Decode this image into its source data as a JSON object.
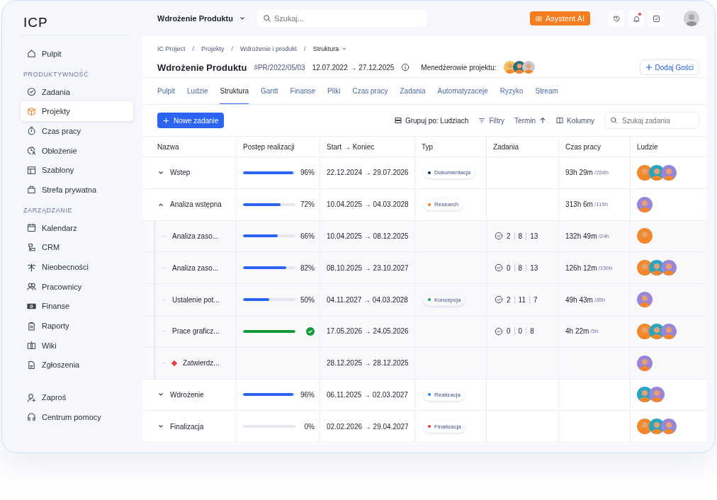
{
  "app": {
    "logo": "ICP"
  },
  "sidebar": {
    "top": [
      {
        "label": "Pulpit",
        "selected": false
      }
    ],
    "sections": [
      {
        "title": "PRODUKTYWNOŚĆ",
        "items": [
          {
            "label": "Zadania",
            "selected": false
          },
          {
            "label": "Projekty",
            "selected": true
          },
          {
            "label": "Czas pracy",
            "selected": false
          },
          {
            "label": "Obłożenie",
            "selected": false
          },
          {
            "label": "Szablony",
            "selected": false
          },
          {
            "label": "Strefa prywatna",
            "selected": false
          }
        ]
      },
      {
        "title": "ZARZĄDZANIE",
        "items": [
          {
            "label": "Kalendarz",
            "selected": false
          },
          {
            "label": "CRM",
            "selected": false
          },
          {
            "label": "Nieobecności",
            "selected": false
          },
          {
            "label": "Pracownicy",
            "selected": false
          },
          {
            "label": "Finanse",
            "selected": false
          },
          {
            "label": "Raporty",
            "selected": false
          },
          {
            "label": "Wiki",
            "selected": false
          },
          {
            "label": "Zgłoszenia",
            "selected": false
          }
        ]
      }
    ],
    "bottom": [
      {
        "label": "Zaproś",
        "selected": false
      },
      {
        "label": "Centrum pomocy",
        "selected": false
      }
    ]
  },
  "topbar": {
    "project": "Wdrożenie Produktu",
    "search": {
      "placeholder": "Szukaj..."
    },
    "assistant": "Asystent AI",
    "unread": true
  },
  "header": {
    "breadcrumb": [
      "IC Project",
      "Projekty",
      "Wdrożenie i produkt",
      "Struktura"
    ],
    "separator": "/",
    "title": "Wdrożenie Produktu",
    "code": "#PR/2022/05/03",
    "dates": "12.07.2022 → 27.12.2025",
    "managers_label": "Menedżerowie projektu:",
    "managers": [
      {
        "color": "#f0c25a"
      },
      {
        "color": "#2f6f78"
      },
      {
        "color": "#c9c9cc"
      }
    ],
    "guest_button": "Dodaj Gości"
  },
  "tabs": [
    {
      "label": "Pulpit",
      "selected": false
    },
    {
      "label": "Ludzie",
      "selected": false
    },
    {
      "label": "Struktura",
      "selected": true
    },
    {
      "label": "Gantt",
      "selected": false
    },
    {
      "label": "Finanse",
      "selected": false
    },
    {
      "label": "Pliki",
      "selected": false
    },
    {
      "label": "Czas pracy",
      "selected": false
    },
    {
      "label": "Zadania",
      "selected": false
    },
    {
      "label": "Automatyzaceje",
      "selected": false
    },
    {
      "label": "Ryzyko",
      "selected": false
    },
    {
      "label": "Stream",
      "selected": false
    }
  ],
  "toolbar": {
    "new_task": "Nowe zadanie",
    "group_by": "Grupuj po: Ludziach",
    "filters": "Filtry",
    "sort": "Termin",
    "columns": "Kolumny",
    "search": {
      "placeholder": "Szukaj zadania"
    }
  },
  "table": {
    "columns": [
      "Nazwa",
      "Postęp realizacji",
      "Start → Koniec",
      "Typ",
      "Zadania",
      "Czas pracy",
      "Ludzie"
    ],
    "rows": [
      {
        "kind": "group",
        "name": "Wstep",
        "expanded": false,
        "level": 0.96,
        "percent": "96%",
        "dates": "22.12.2024 → 29.07.2026",
        "type": {
          "label": "Dokumentacja",
          "color": "#1b2a5c"
        },
        "time": "93h 29m",
        "budget": "/258h",
        "people": [
          {
            "color": "#f08a2c"
          },
          {
            "color": "#2aa5c0"
          },
          {
            "color": "#9a86d8"
          }
        ]
      },
      {
        "kind": "group",
        "name": "Analiza wstępna",
        "expanded": true,
        "level": 0.72,
        "percent": "72%",
        "dates": "10.04.2025 → 04.03.2028",
        "type": {
          "label": "Research",
          "color": "#f57c1f"
        },
        "time": "313h 6m",
        "budget": "/115h",
        "people": [
          {
            "color": "#9a86d8"
          }
        ],
        "children": [
          {
            "kind": "task",
            "name": "Analiza zaso...",
            "level": 0.66,
            "percent": "66%",
            "dates": "10.04.2025 → 08.12.2025",
            "tasks": [
              "2",
              "8",
              "13"
            ],
            "time": "132h 49m",
            "budget": "/24h",
            "people": [
              {
                "color": "#f08a2c"
              }
            ]
          },
          {
            "kind": "task",
            "name": "Analiza zaso...",
            "level": 0.82,
            "percent": "82%",
            "dates": "08.10.2025 → 23.10.2027",
            "tasks": [
              "0",
              "8",
              "13"
            ],
            "time": "126h 12m",
            "budget": "/150h",
            "people": [
              {
                "color": "#f08a2c"
              },
              {
                "color": "#2aa5c0"
              },
              {
                "color": "#9a86d8"
              }
            ]
          },
          {
            "kind": "task",
            "name": "Ustalenie pot...",
            "level": 0.5,
            "percent": "50%",
            "dates": "04.11.2027 → 04.03.2028",
            "type": {
              "label": "Koncepcja",
              "color": "#18a35a"
            },
            "tasks": [
              "2",
              "11",
              "7"
            ],
            "time": "49h 43m",
            "budget": "/35h",
            "people": [
              {
                "color": "#9a86d8"
              }
            ]
          },
          {
            "kind": "task",
            "name": "Prace graficz...",
            "level": 1,
            "dates": "17.05.2026 → 24.05.2026",
            "tasks": [
              "0",
              "0",
              "8"
            ],
            "time": "4h 22m",
            "budget": "/5h",
            "people": [
              {
                "color": "#f08a2c"
              },
              {
                "color": "#2aa5c0"
              },
              {
                "color": "#9a86d8"
              }
            ]
          },
          {
            "kind": "milestone",
            "name": "Zatwierdz...",
            "dates": "28.12.2025 → 28.12.2025",
            "people": [
              {
                "color": "#9a86d8"
              }
            ]
          }
        ]
      },
      {
        "kind": "group",
        "name": "Wdrożenie",
        "expanded": false,
        "level": 0.96,
        "percent": "96%",
        "dates": "06.11.2025 → 02.03.2027",
        "type": {
          "label": "Realizacja",
          "color": "#1e7fe0"
        },
        "people": [
          {
            "color": "#2aa5c0"
          },
          {
            "color": "#9a86d8"
          }
        ]
      },
      {
        "kind": "group",
        "name": "Finalizacja",
        "expanded": false,
        "level": 0,
        "percent": "0%",
        "dates": "02.02.2026 → 29.04.2027",
        "type": {
          "label": "Finalizacja",
          "color": "#e53935"
        },
        "people": [
          {
            "color": "#f08a2c"
          },
          {
            "color": "#2aa5c0"
          },
          {
            "color": "#9a86d8"
          }
        ]
      }
    ]
  }
}
